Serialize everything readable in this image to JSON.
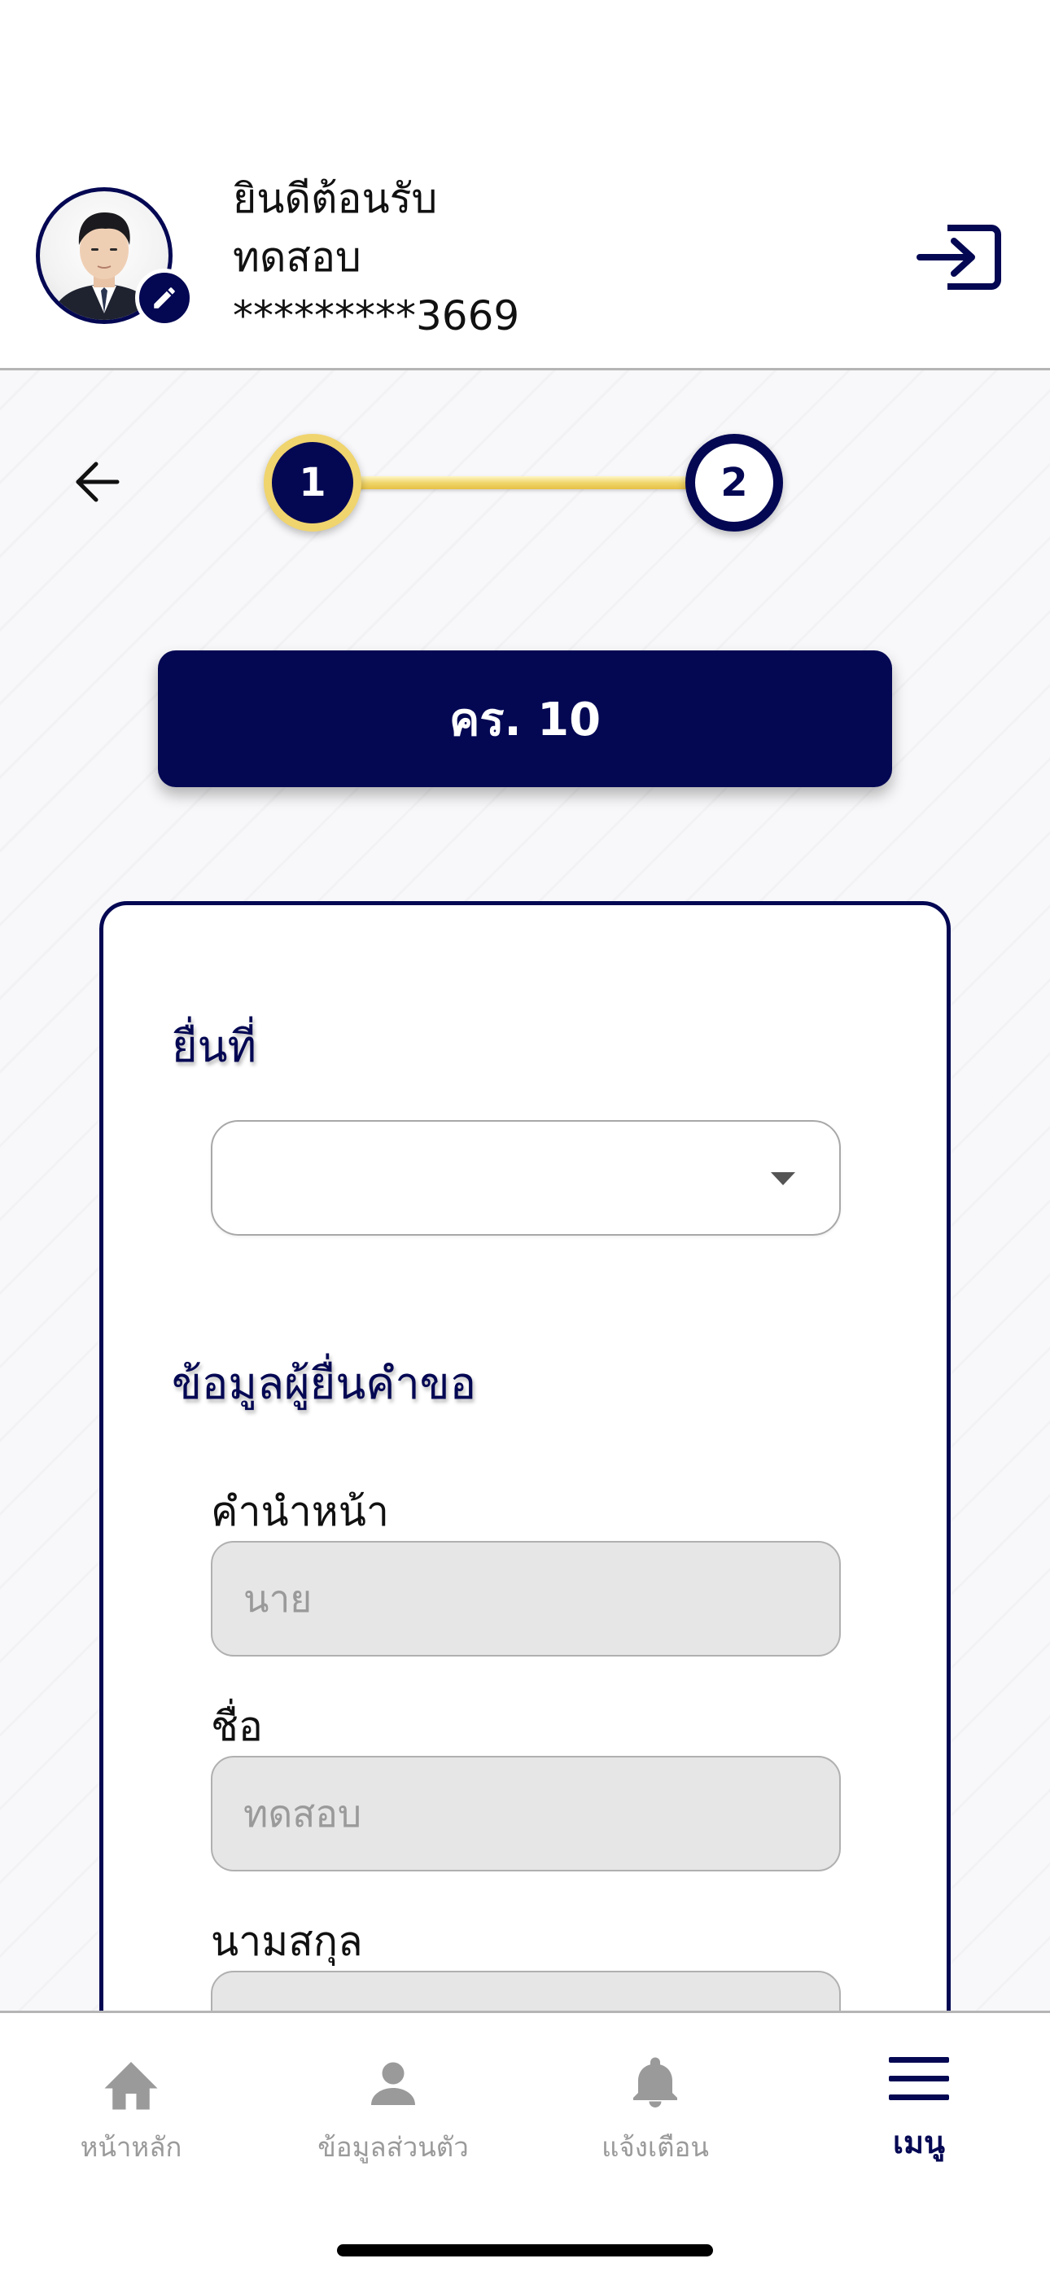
{
  "colors": {
    "primary_navy": "#040853",
    "gold_accent": "#f0d46e",
    "input_gray": "#e6e6e6",
    "muted_gray": "#9a9a9a"
  },
  "header": {
    "greeting": "ยินดีต้อนรับ",
    "user_name": "ทดสอบ",
    "masked_id": "*********3669",
    "logout_icon": "logout-icon",
    "edit_icon": "pencil-icon"
  },
  "stepper": {
    "back_icon": "arrow-left-icon",
    "steps": [
      {
        "label": "1",
        "state": "active"
      },
      {
        "label": "2",
        "state": "pending"
      }
    ]
  },
  "form": {
    "title": "คร. 10",
    "submit_at_label": "ยื่นที่",
    "submit_at_value": "",
    "applicant_section_title": "ข้อมูลผู้ยื่นคำขอ",
    "fields": [
      {
        "label": "คำนำหน้า",
        "value": "นาย"
      },
      {
        "label": "ชื่อ",
        "value": "ทดสอบ"
      },
      {
        "label": "นามสกุล",
        "value": ""
      }
    ]
  },
  "nav": {
    "items": [
      {
        "label": "หน้าหลัก",
        "icon": "home-icon",
        "active": false
      },
      {
        "label": "ข้อมูลส่วนตัว",
        "icon": "person-icon",
        "active": false
      },
      {
        "label": "แจ้งเตือน",
        "icon": "bell-icon",
        "active": false
      },
      {
        "label": "เมนู",
        "icon": "menu-icon",
        "active": true
      }
    ]
  }
}
